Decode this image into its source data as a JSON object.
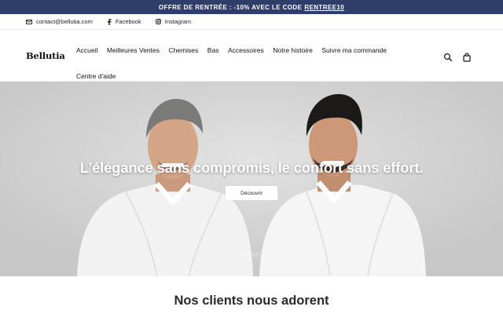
{
  "announcement": {
    "text": "OFFRE DE RENTRÉE : -10% AVEC LE CODE",
    "code": "RENTREE10",
    "background": "#2f3d6b"
  },
  "contact_bar": {
    "email": "contact@bellutia.com",
    "facebook": "Facebook",
    "instagram": "Instagram"
  },
  "header": {
    "logo": "Bellutia",
    "nav": [
      "Accueil",
      "Meilleures Ventes",
      "Chemises",
      "Bas",
      "Accessoires",
      "Notre histoire",
      "Suivre ma commande",
      "Centre d'aide"
    ],
    "icons": [
      "search-icon",
      "bag-icon"
    ]
  },
  "hero": {
    "title": "L'élégance sans compromis, le confort sans effort.",
    "button": "Découvrir",
    "brand": "BELLUTIA"
  },
  "section": {
    "title": "Nos clients nous adorent"
  }
}
